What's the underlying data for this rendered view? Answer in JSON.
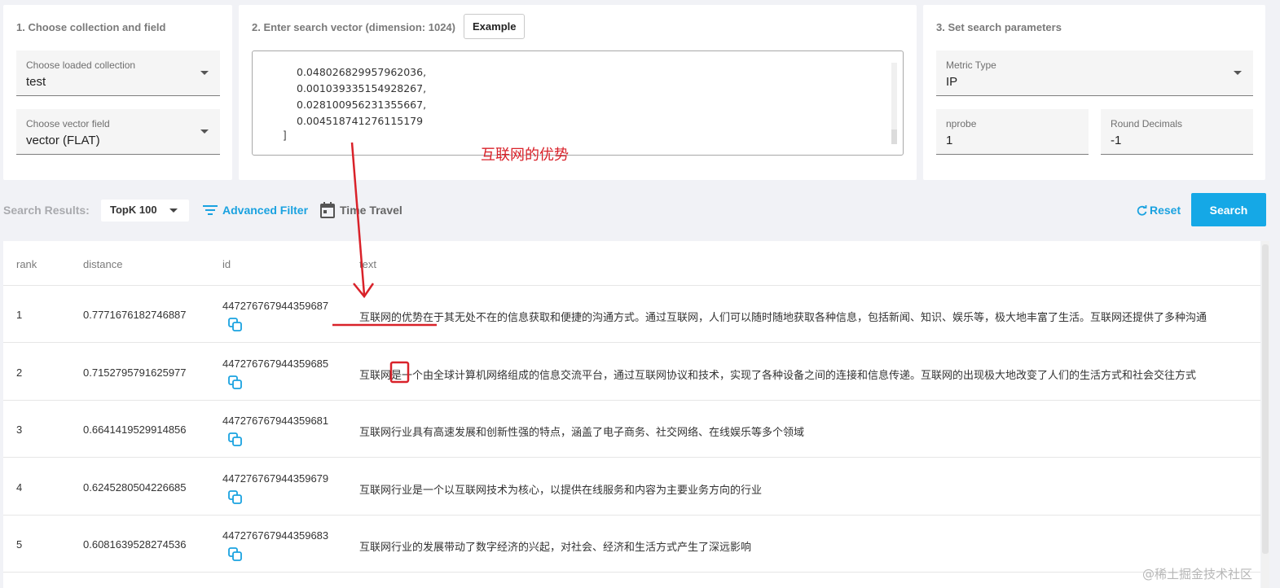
{
  "collection_card": {
    "title": "1. Choose collection and field",
    "collection_label": "Choose loaded collection",
    "collection_value": "test",
    "vector_field_label": "Choose vector field",
    "vector_field_value": "vector (FLAT)"
  },
  "vector_card": {
    "title": "2. Enter search vector (dimension: 1024)",
    "example_button": "Example",
    "vector_lines": [
      "0.048026829957962036,",
      "0.001039335154928267,",
      "0.028100956231355667,",
      "0.004518741276115179"
    ],
    "vector_close": "]"
  },
  "params_card": {
    "title": "3. Set search parameters",
    "metric_label": "Metric Type",
    "metric_value": "IP",
    "nprobe_label": "nprobe",
    "nprobe_value": "1",
    "round_label": "Round Decimals",
    "round_value": "-1"
  },
  "toolbar": {
    "label": "Search Results:",
    "topk_value": "TopK 100",
    "advanced_filter": "Advanced Filter",
    "time_travel": "Time Travel",
    "reset": "Reset",
    "search": "Search"
  },
  "table": {
    "columns": [
      "rank",
      "distance",
      "id",
      "text"
    ],
    "rows": [
      {
        "rank": "1",
        "distance": "0.7771676182746887",
        "id": "447276767944359687",
        "text": "互联网的优势在于其无处不在的信息获取和便捷的沟通方式。通过互联网，人们可以随时随地获取各种信息，包括新闻、知识、娱乐等，极大地丰富了生活。互联网还提供了多种沟通"
      },
      {
        "rank": "2",
        "distance": "0.7152795791625977",
        "id": "447276767944359685",
        "text": "互联网是一个由全球计算机网络组成的信息交流平台，通过互联网协议和技术，实现了各种设备之间的连接和信息传递。互联网的出现极大地改变了人们的生活方式和社会交往方式"
      },
      {
        "rank": "3",
        "distance": "0.6641419529914856",
        "id": "447276767944359681",
        "text": "互联网行业具有高速发展和创新性强的特点，涵盖了电子商务、社交网络、在线娱乐等多个领域"
      },
      {
        "rank": "4",
        "distance": "0.6245280504226685",
        "id": "447276767944359679",
        "text": "互联网行业是一个以互联网技术为核心，以提供在线服务和内容为主要业务方向的行业"
      },
      {
        "rank": "5",
        "distance": "0.6081639528274536",
        "id": "447276767944359683",
        "text": "互联网行业的发展带动了数字经济的兴起，对社会、经济和生活方式产生了深远影响"
      }
    ]
  },
  "annotation": {
    "text": "互联网的优势",
    "color": "#d9222a"
  },
  "watermark": "@稀土掘金技术社区",
  "colors": {
    "accent": "#15a8e6",
    "background": "#f1f2f6"
  }
}
